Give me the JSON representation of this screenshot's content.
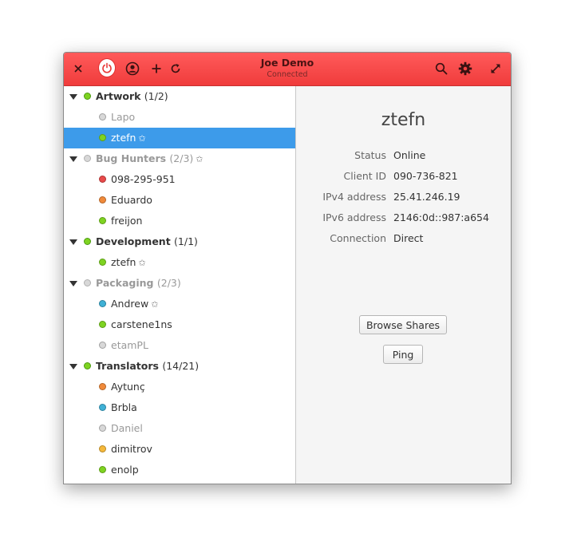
{
  "titlebar": {
    "title": "Joe Demo",
    "subtitle": "Connected",
    "accent_color": "#f24444"
  },
  "groups": [
    {
      "name": "Artwork",
      "count": "(1/2)",
      "online": true,
      "favorite": false,
      "members": [
        {
          "name": "Lapo",
          "status": "offline",
          "color": "#d8d8d8",
          "favorite": false
        },
        {
          "name": "ztefn",
          "status": "online",
          "color": "#7ed321",
          "favorite": true,
          "selected": true
        }
      ]
    },
    {
      "name": "Bug Hunters",
      "count": "(2/3)",
      "online": false,
      "favorite": true,
      "members": [
        {
          "name": "098-295-951",
          "status": "busy",
          "color": "#e84a4a",
          "favorite": false
        },
        {
          "name": "Eduardo",
          "status": "away",
          "color": "#f08a3a",
          "favorite": false
        },
        {
          "name": "freijon",
          "status": "online",
          "color": "#7ed321",
          "favorite": false
        }
      ]
    },
    {
      "name": "Development",
      "count": "(1/1)",
      "online": true,
      "favorite": false,
      "members": [
        {
          "name": "ztefn",
          "status": "online",
          "color": "#7ed321",
          "favorite": true
        }
      ]
    },
    {
      "name": "Packaging",
      "count": "(2/3)",
      "online": false,
      "favorite": false,
      "members": [
        {
          "name": "Andrew",
          "status": "idle",
          "color": "#3fb1d6",
          "favorite": true
        },
        {
          "name": "carstene1ns",
          "status": "online",
          "color": "#7ed321",
          "favorite": false
        },
        {
          "name": "etamPL",
          "status": "offline",
          "color": "#d8d8d8",
          "favorite": false
        }
      ]
    },
    {
      "name": "Translators",
      "count": "(14/21)",
      "online": true,
      "favorite": false,
      "members": [
        {
          "name": "Aytunç",
          "status": "away",
          "color": "#f08a3a",
          "favorite": false
        },
        {
          "name": "Brbla",
          "status": "idle",
          "color": "#3fb1d6",
          "favorite": false
        },
        {
          "name": "Daniel",
          "status": "offline",
          "color": "#d8d8d8",
          "favorite": false
        },
        {
          "name": "dimitrov",
          "status": "away",
          "color": "#f5b83a",
          "favorite": false
        },
        {
          "name": "enolp",
          "status": "online",
          "color": "#7ed321",
          "favorite": false
        }
      ]
    }
  ],
  "details": {
    "peer_name": "ztefn",
    "fields": [
      {
        "label": "Status",
        "value": "Online"
      },
      {
        "label": "Client ID",
        "value": "090-736-821"
      },
      {
        "label": "IPv4 address",
        "value": "25.41.246.19"
      },
      {
        "label": "IPv6 address",
        "value": "2146:0d::987:a654"
      },
      {
        "label": "Connection",
        "value": "Direct"
      }
    ],
    "browse_label": "Browse Shares",
    "ping_label": "Ping"
  },
  "icons": [
    "close-icon",
    "power-icon",
    "account-icon",
    "add-icon",
    "refresh-icon",
    "search-icon",
    "gear-icon",
    "maximize-icon",
    "expander-arrow-icon",
    "star-icon",
    "status-dot-icon"
  ]
}
